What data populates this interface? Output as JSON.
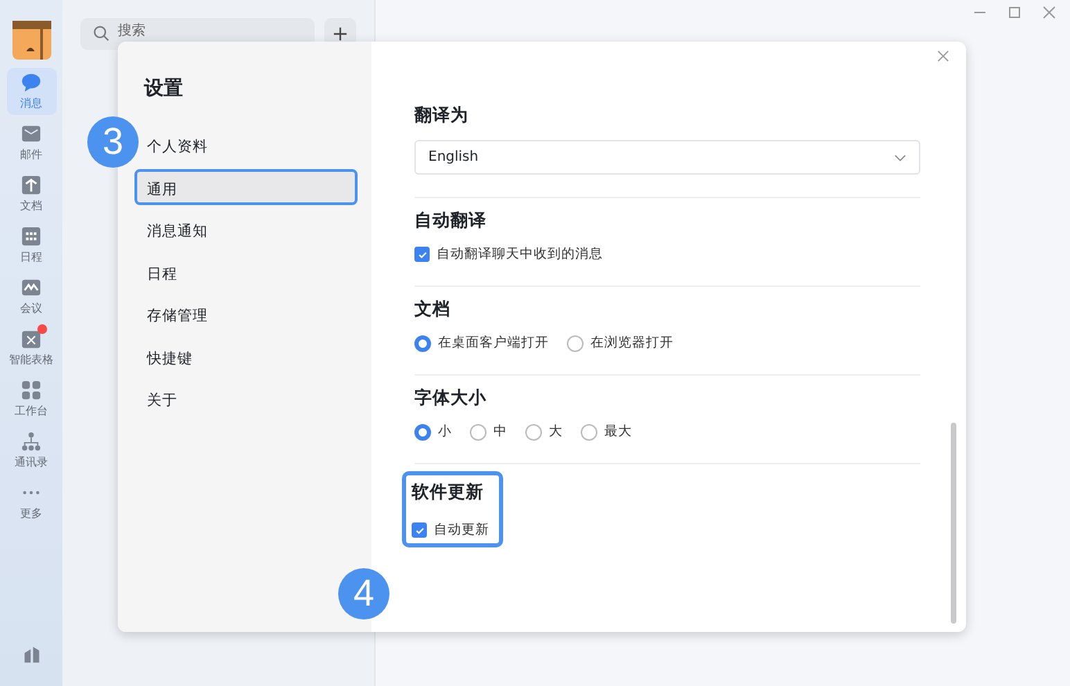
{
  "sidebar": {
    "items": [
      {
        "label": "消息",
        "selected": true,
        "badge": false
      },
      {
        "label": "邮件",
        "selected": false,
        "badge": false
      },
      {
        "label": "文档",
        "selected": false,
        "badge": false
      },
      {
        "label": "日程",
        "selected": false,
        "badge": false
      },
      {
        "label": "会议",
        "selected": false,
        "badge": false
      },
      {
        "label": "智能表格",
        "selected": false,
        "badge": true
      },
      {
        "label": "工作台",
        "selected": false,
        "badge": false
      },
      {
        "label": "通讯录",
        "selected": false,
        "badge": false
      },
      {
        "label": "更多",
        "selected": false,
        "badge": false
      }
    ]
  },
  "search": {
    "placeholder": "搜索"
  },
  "dialog": {
    "title": "设置",
    "nav": [
      {
        "label": "个人资料",
        "selected": false,
        "highlighted": false
      },
      {
        "label": "通用",
        "selected": true,
        "highlighted": true
      },
      {
        "label": "消息通知",
        "selected": false,
        "highlighted": false
      },
      {
        "label": "日程",
        "selected": false,
        "highlighted": false
      },
      {
        "label": "存储管理",
        "selected": false,
        "highlighted": false
      },
      {
        "label": "快捷键",
        "selected": false,
        "highlighted": false
      },
      {
        "label": "关于",
        "selected": false,
        "highlighted": false
      }
    ],
    "sections": [
      {
        "title": "翻译为",
        "kind": "select",
        "highlighted": false,
        "value": "English"
      },
      {
        "title": "自动翻译",
        "kind": "checkbox",
        "highlighted": false,
        "options": [
          {
            "label": "自动翻译聊天中收到的消息",
            "checked": true
          }
        ]
      },
      {
        "title": "文档",
        "kind": "radio",
        "highlighted": false,
        "options": [
          {
            "label": "在桌面客户端打开",
            "selected": true
          },
          {
            "label": "在浏览器打开",
            "selected": false
          }
        ]
      },
      {
        "title": "字体大小",
        "kind": "radio",
        "highlighted": false,
        "options": [
          {
            "label": "小",
            "selected": true
          },
          {
            "label": "中",
            "selected": false
          },
          {
            "label": "大",
            "selected": false
          },
          {
            "label": "最大",
            "selected": false
          }
        ]
      },
      {
        "title": "软件更新",
        "kind": "checkbox",
        "highlighted": true,
        "options": [
          {
            "label": "自动更新",
            "checked": true
          }
        ]
      }
    ]
  },
  "annotations": [
    {
      "label": "3"
    },
    {
      "label": "4"
    }
  ]
}
